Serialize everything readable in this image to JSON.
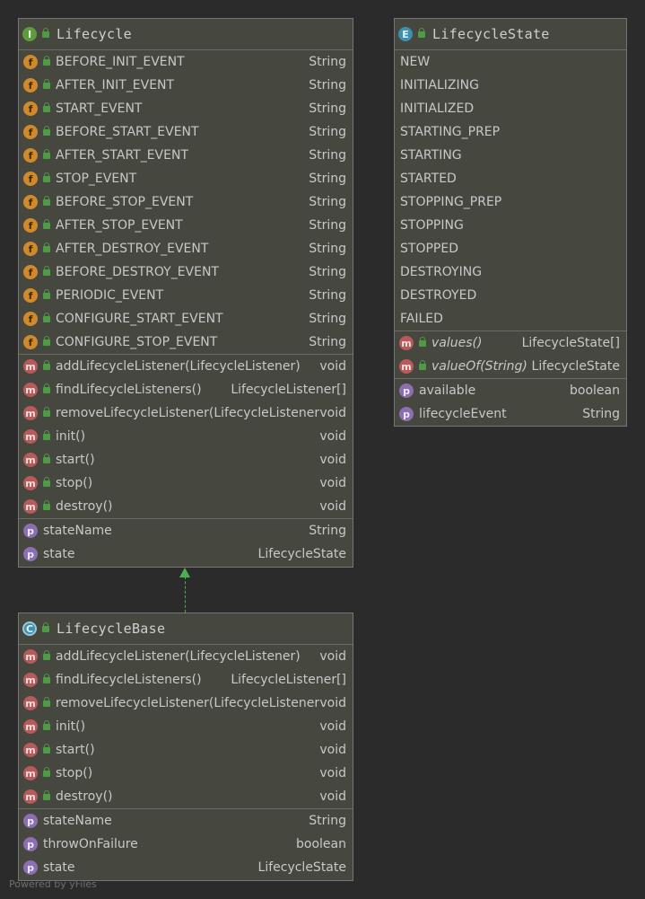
{
  "lifecycle": {
    "name": "Lifecycle",
    "kind_letter": "I",
    "fields": [
      {
        "name": "BEFORE_INIT_EVENT",
        "type": "String"
      },
      {
        "name": "AFTER_INIT_EVENT",
        "type": "String"
      },
      {
        "name": "START_EVENT",
        "type": "String"
      },
      {
        "name": "BEFORE_START_EVENT",
        "type": "String"
      },
      {
        "name": "AFTER_START_EVENT",
        "type": "String"
      },
      {
        "name": "STOP_EVENT",
        "type": "String"
      },
      {
        "name": "BEFORE_STOP_EVENT",
        "type": "String"
      },
      {
        "name": "AFTER_STOP_EVENT",
        "type": "String"
      },
      {
        "name": "AFTER_DESTROY_EVENT",
        "type": "String"
      },
      {
        "name": "BEFORE_DESTROY_EVENT",
        "type": "String"
      },
      {
        "name": "PERIODIC_EVENT",
        "type": "String"
      },
      {
        "name": "CONFIGURE_START_EVENT",
        "type": "String"
      },
      {
        "name": "CONFIGURE_STOP_EVENT",
        "type": "String"
      }
    ],
    "methods": [
      {
        "name": "addLifecycleListener(LifecycleListener)",
        "type": "void"
      },
      {
        "name": "findLifecycleListeners()",
        "type": "LifecycleListener[]"
      },
      {
        "name": "removeLifecycleListener(LifecycleListener)",
        "type": "void"
      },
      {
        "name": "init()",
        "type": "void"
      },
      {
        "name": "start()",
        "type": "void"
      },
      {
        "name": "stop()",
        "type": "void"
      },
      {
        "name": "destroy()",
        "type": "void"
      }
    ],
    "properties": [
      {
        "name": "stateName",
        "type": "String"
      },
      {
        "name": "state",
        "type": "LifecycleState"
      }
    ]
  },
  "lifecycle_state": {
    "name": "LifecycleState",
    "kind_letter": "E",
    "constants": [
      "NEW",
      "INITIALIZING",
      "INITIALIZED",
      "STARTING_PREP",
      "STARTING",
      "STARTED",
      "STOPPING_PREP",
      "STOPPING",
      "STOPPED",
      "DESTROYING",
      "DESTROYED",
      "FAILED"
    ],
    "methods": [
      {
        "name": "values()",
        "type": "LifecycleState[]"
      },
      {
        "name": "valueOf(String)",
        "type": "LifecycleState"
      }
    ],
    "properties": [
      {
        "name": "available",
        "type": "boolean"
      },
      {
        "name": "lifecycleEvent",
        "type": "String"
      }
    ]
  },
  "lifecycle_base": {
    "name": "LifecycleBase",
    "kind_letter": "C",
    "methods": [
      {
        "name": "addLifecycleListener(LifecycleListener)",
        "type": "void"
      },
      {
        "name": "findLifecycleListeners()",
        "type": "LifecycleListener[]"
      },
      {
        "name": "removeLifecycleListener(LifecycleListener)",
        "type": "void"
      },
      {
        "name": "init()",
        "type": "void"
      },
      {
        "name": "start()",
        "type": "void"
      },
      {
        "name": "stop()",
        "type": "void"
      },
      {
        "name": "destroy()",
        "type": "void"
      }
    ],
    "properties": [
      {
        "name": "stateName",
        "type": "String"
      },
      {
        "name": "throwOnFailure",
        "type": "boolean"
      },
      {
        "name": "state",
        "type": "LifecycleState"
      }
    ]
  },
  "footer": "Powered by yFiles",
  "colors": {
    "background": "#2b2b2b",
    "box": "#46483f",
    "arrow": "#4caf50"
  }
}
